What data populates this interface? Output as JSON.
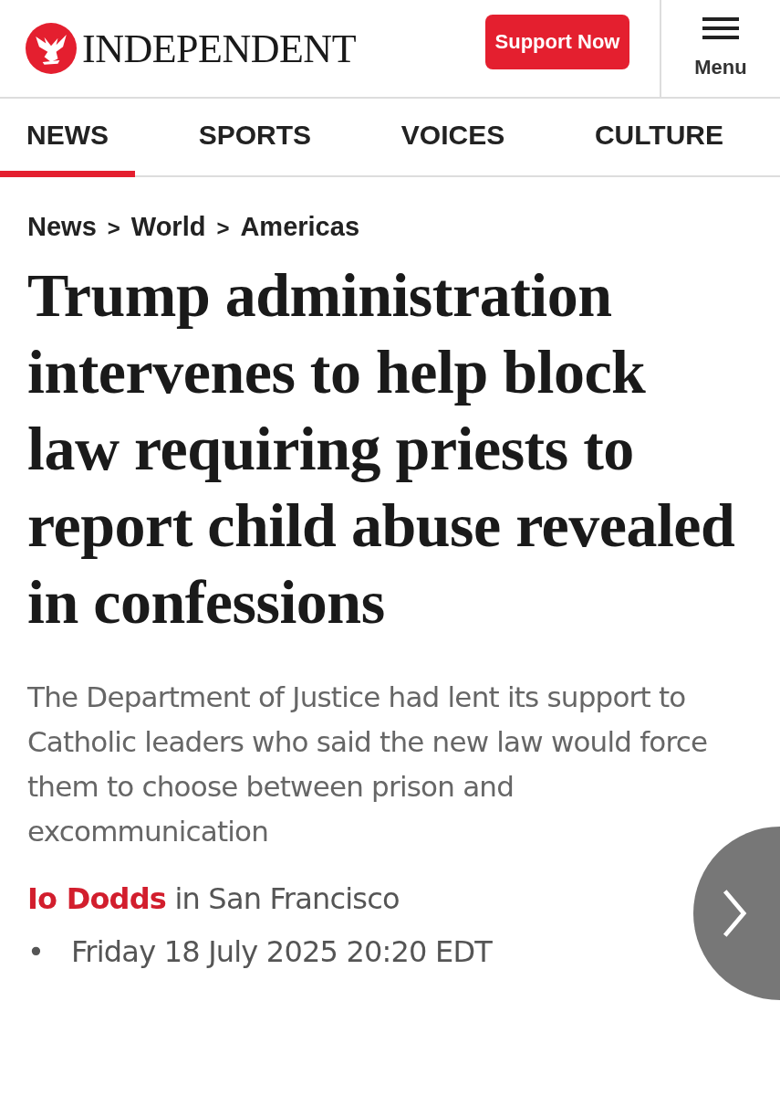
{
  "header": {
    "logo_text": "INDEPENDENT",
    "support_button": "Support Now",
    "menu_label": "Menu"
  },
  "nav_tabs": [
    {
      "label": "NEWS",
      "selected": true
    },
    {
      "label": "SPORTS",
      "selected": false
    },
    {
      "label": "VOICES",
      "selected": false
    },
    {
      "label": "CULTURE",
      "selected": false
    }
  ],
  "breadcrumb": [
    {
      "kind": "link",
      "label": "News"
    },
    {
      "kind": "separator",
      "label": ">"
    },
    {
      "kind": "link",
      "label": "World"
    },
    {
      "kind": "separator",
      "label": ">"
    },
    {
      "kind": "link",
      "label": "Americas"
    }
  ],
  "headline": "Trump administration intervenes to help block law requiring priests to report child abuse revealed in confessions",
  "standfirst": "The Department of Justice had lent its support to Catholic leaders who said the new law would force them to choose between prison and excommunication",
  "byline": {
    "author": "Io Dodds",
    "location": "in San Francisco"
  },
  "dateline": {
    "bullet": "•",
    "date": "Friday 18 July 2025 20:20 EDT"
  }
}
